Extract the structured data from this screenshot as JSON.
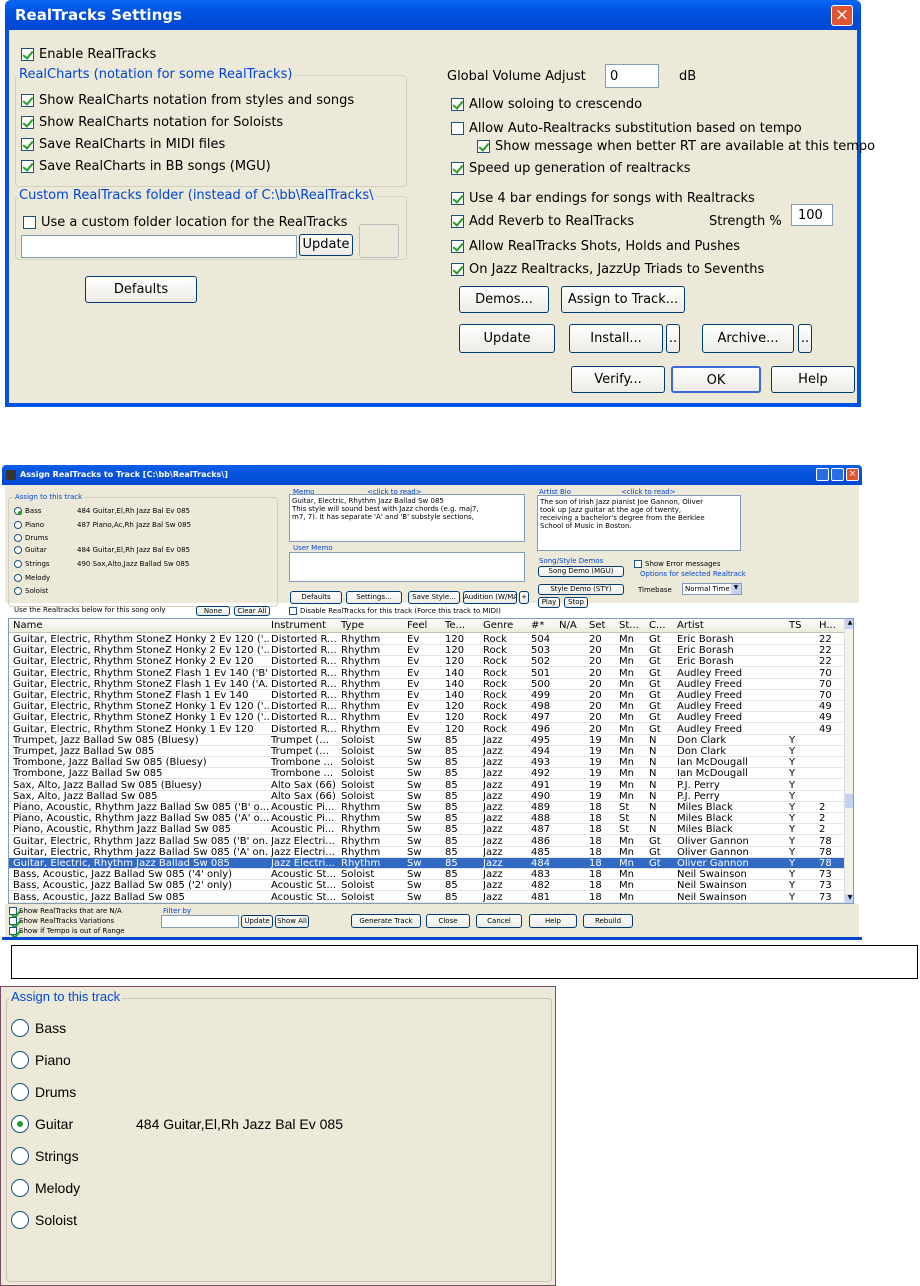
{
  "settings": {
    "title": "RealTracks Settings",
    "enable": "Enable RealTracks",
    "realcharts_group": "RealCharts (notation for some RealTracks)",
    "rc1": "Show RealCharts notation from styles and songs",
    "rc2": "Show RealCharts notation for Soloists",
    "rc3": "Save RealCharts in MIDI files",
    "rc4": "Save RealCharts in BB songs (MGU)",
    "custom_group": "Custom RealTracks folder (instead of C:\\bb\\RealTracks\\",
    "custom_cb": "Use a custom folder location for the RealTracks",
    "update_small": "Update",
    "defaults": "Defaults",
    "gva_label": "Global Volume Adjust",
    "gva_value": "0",
    "gva_unit": "dB",
    "o1": "Allow soloing to crescendo",
    "o2": "Allow Auto-Realtracks substitution based on tempo",
    "o3": "Show message when better RT are available at this tempo",
    "o4": "Speed up generation of realtracks",
    "o5": "Use 4 bar endings for songs with Realtracks",
    "o6": "Add Reverb to RealTracks",
    "strength_label": "Strength %",
    "strength_value": "100",
    "o7": "Allow RealTracks Shots, Holds and Pushes",
    "o8": "On Jazz Realtracks, JazzUp Triads to Sevenths",
    "demos": "Demos...",
    "assign": "Assign to Track...",
    "update": "Update",
    "install": "Install...",
    "archive": "Archive...",
    "dots": "..",
    "verify": "Verify...",
    "ok": "OK",
    "help": "Help",
    "close": "×"
  },
  "assign": {
    "title": "Assign RealTracks to Track  [C:\\bb\\RealTracks\\]",
    "group": "Assign to this track",
    "tracks": [
      {
        "name": "Bass",
        "value": "484 Guitar,El,Rh Jazz Bal Ev 085"
      },
      {
        "name": "Piano",
        "value": "487 Piano,Ac,Rh Jazz Bal Sw 085"
      },
      {
        "name": "Drums",
        "value": ""
      },
      {
        "name": "Guitar",
        "value": "484 Guitar,El,Rh Jazz Bal Ev 085"
      },
      {
        "name": "Strings",
        "value": "490 Sax,Alto,Jazz Ballad Sw 085"
      },
      {
        "name": "Melody",
        "value": ""
      },
      {
        "name": "Soloist",
        "value": ""
      }
    ],
    "use_below": "Use the Realtracks below for this song only",
    "none": "None",
    "clear_all": "Clear All",
    "memo": "Memo",
    "click_read": "<click to read>",
    "memo_text": [
      "Guitar, Electric, Rhythm Jazz Ballad Sw 085",
      "This style will sound best with Jazz chords (e.g. maj7,",
      "m7, 7).  It has separate 'A' and 'B' substyle sections,"
    ],
    "artist_bio": "Artist Bio",
    "bio_text": [
      "The son of Irish Jazz pianist Joe Gannon, Oliver",
      "took up Jazz guitar at the age of twenty,",
      "receiving a bachelor's degree from the Berklee",
      "School of Music in Boston."
    ],
    "user_memo": "User Memo",
    "song_demos": "Song/Style Demos",
    "song_demo": "Song Demo (MGU)",
    "style_demo": "Style Demo (STY)",
    "play": "Play",
    "stop": "Stop",
    "show_err": "Show Error messages",
    "options_sel": "Options for selected Realtrack",
    "timebase": "Timebase",
    "timebase_val": "Normal Time",
    "b_defaults": "Defaults",
    "b_settings": "Settings...",
    "b_save": "Save Style...",
    "b_audition": "Audition (W/MA)",
    "b_plus": "+",
    "disable": "Disable RealTracks for this track (Force this track to MIDI)",
    "columns": [
      "Name",
      "Instrument",
      "Type",
      "Feel",
      "Te...",
      "Genre",
      "#*",
      "N/A",
      "Set",
      "St...",
      "C...",
      "Artist",
      "TS",
      "H..."
    ],
    "rows": [
      [
        "Guitar, Electric, Rhythm StoneZ Honky 2 Ev 120 ('...",
        "Distorted R...",
        "Rhythm",
        "Ev",
        "120",
        "Rock",
        "504",
        "",
        "20",
        "Mn",
        "Gt",
        "Eric Borash",
        "",
        "22"
      ],
      [
        "Guitar, Electric, Rhythm StoneZ Honky 2 Ev 120 ('...",
        "Distorted R...",
        "Rhythm",
        "Ev",
        "120",
        "Rock",
        "503",
        "",
        "20",
        "Mn",
        "Gt",
        "Eric Borash",
        "",
        "22"
      ],
      [
        "Guitar, Electric, Rhythm StoneZ Honky 2 Ev 120",
        "Distorted R...",
        "Rhythm",
        "Ev",
        "120",
        "Rock",
        "502",
        "",
        "20",
        "Mn",
        "Gt",
        "Eric Borash",
        "",
        "22"
      ],
      [
        "Guitar, Electric, Rhythm StoneZ Flash 1 Ev 140 ('B'...",
        "Distorted R...",
        "Rhythm",
        "Ev",
        "140",
        "Rock",
        "501",
        "",
        "20",
        "Mn",
        "Gt",
        "Audley Freed",
        "",
        "70"
      ],
      [
        "Guitar, Electric, Rhythm StoneZ Flash 1 Ev 140 ('A...",
        "Distorted R...",
        "Rhythm",
        "Ev",
        "140",
        "Rock",
        "500",
        "",
        "20",
        "Mn",
        "Gt",
        "Audley Freed",
        "",
        "70"
      ],
      [
        "Guitar, Electric, Rhythm StoneZ Flash 1 Ev 140",
        "Distorted R...",
        "Rhythm",
        "Ev",
        "140",
        "Rock",
        "499",
        "",
        "20",
        "Mn",
        "Gt",
        "Audley Freed",
        "",
        "70"
      ],
      [
        "Guitar, Electric, Rhythm StoneZ Honky 1 Ev 120 ('...",
        "Distorted R...",
        "Rhythm",
        "Ev",
        "120",
        "Rock",
        "498",
        "",
        "20",
        "Mn",
        "Gt",
        "Audley Freed",
        "",
        "49"
      ],
      [
        "Guitar, Electric, Rhythm StoneZ Honky 1 Ev 120 ('...",
        "Distorted R...",
        "Rhythm",
        "Ev",
        "120",
        "Rock",
        "497",
        "",
        "20",
        "Mn",
        "Gt",
        "Audley Freed",
        "",
        "49"
      ],
      [
        "Guitar, Electric, Rhythm StoneZ Honky 1 Ev 120",
        "Distorted R...",
        "Rhythm",
        "Ev",
        "120",
        "Rock",
        "496",
        "",
        "20",
        "Mn",
        "Gt",
        "Audley Freed",
        "",
        "49"
      ],
      [
        "Trumpet, Jazz Ballad Sw 085 (Bluesy)",
        "Trumpet (...",
        "Soloist",
        "Sw",
        "85",
        "Jazz",
        "495",
        "",
        "19",
        "Mn",
        "N",
        "Don Clark",
        "Y",
        ""
      ],
      [
        "Trumpet, Jazz Ballad Sw 085",
        "Trumpet (...",
        "Soloist",
        "Sw",
        "85",
        "Jazz",
        "494",
        "",
        "19",
        "Mn",
        "N",
        "Don Clark",
        "Y",
        ""
      ],
      [
        "Trombone, Jazz Ballad Sw 085 (Bluesy)",
        "Trombone ...",
        "Soloist",
        "Sw",
        "85",
        "Jazz",
        "493",
        "",
        "19",
        "Mn",
        "N",
        "Ian McDougall",
        "Y",
        ""
      ],
      [
        "Trombone, Jazz Ballad Sw 085",
        "Trombone ...",
        "Soloist",
        "Sw",
        "85",
        "Jazz",
        "492",
        "",
        "19",
        "Mn",
        "N",
        "Ian McDougall",
        "Y",
        ""
      ],
      [
        "Sax, Alto, Jazz Ballad Sw 085 (Bluesy)",
        "Alto Sax (66)",
        "Soloist",
        "Sw",
        "85",
        "Jazz",
        "491",
        "",
        "19",
        "Mn",
        "N",
        "P.J. Perry",
        "Y",
        ""
      ],
      [
        "Sax, Alto, Jazz Ballad Sw 085",
        "Alto Sax (66)",
        "Soloist",
        "Sw",
        "85",
        "Jazz",
        "490",
        "",
        "19",
        "Mn",
        "N",
        "P.J. Perry",
        "Y",
        ""
      ],
      [
        "Piano, Acoustic, Rhythm Jazz Ballad Sw 085 ('B' o...",
        "Acoustic Pi...",
        "Rhythm",
        "Sw",
        "85",
        "Jazz",
        "489",
        "",
        "18",
        "St",
        "N",
        "Miles Black",
        "Y",
        "2"
      ],
      [
        "Piano, Acoustic, Rhythm Jazz Ballad Sw 085 ('A' o...",
        "Acoustic Pi...",
        "Rhythm",
        "Sw",
        "85",
        "Jazz",
        "488",
        "",
        "18",
        "St",
        "N",
        "Miles Black",
        "Y",
        "2"
      ],
      [
        "Piano, Acoustic, Rhythm Jazz Ballad Sw 085",
        "Acoustic Pi...",
        "Rhythm",
        "Sw",
        "85",
        "Jazz",
        "487",
        "",
        "18",
        "St",
        "N",
        "Miles Black",
        "Y",
        "2"
      ],
      [
        "Guitar, Electric, Rhythm Jazz Ballad Sw 085 ('B' on...",
        "Jazz Electri...",
        "Rhythm",
        "Sw",
        "85",
        "Jazz",
        "486",
        "",
        "18",
        "Mn",
        "Gt",
        "Oliver Gannon",
        "Y",
        "78"
      ],
      [
        "Guitar, Electric, Rhythm Jazz Ballad Sw 085 ('A' on...",
        "Jazz Electri...",
        "Rhythm",
        "Sw",
        "85",
        "Jazz",
        "485",
        "",
        "18",
        "Mn",
        "Gt",
        "Oliver Gannon",
        "Y",
        "78"
      ],
      [
        "Guitar, Electric, Rhythm Jazz Ballad Sw 085",
        "Jazz Electri...",
        "Rhythm",
        "Sw",
        "85",
        "Jazz",
        "484",
        "",
        "18",
        "Mn",
        "Gt",
        "Oliver Gannon",
        "Y",
        "78"
      ],
      [
        "Bass, Acoustic, Jazz Ballad Sw 085 ('4' only)",
        "Acoustic St...",
        "Soloist",
        "Sw",
        "85",
        "Jazz",
        "483",
        "",
        "18",
        "Mn",
        "",
        "Neil Swainson",
        "Y",
        "73"
      ],
      [
        "Bass, Acoustic, Jazz Ballad Sw 085 ('2' only)",
        "Acoustic St...",
        "Soloist",
        "Sw",
        "85",
        "Jazz",
        "482",
        "",
        "18",
        "Mn",
        "",
        "Neil Swainson",
        "Y",
        "73"
      ],
      [
        "Bass, Acoustic, Jazz Ballad Sw 085",
        "Acoustic St...",
        "Soloist",
        "Sw",
        "85",
        "Jazz",
        "481",
        "",
        "18",
        "Mn",
        "",
        "Neil Swainson",
        "Y",
        "73"
      ]
    ],
    "show_na": "Show RealTracks that are N/A",
    "show_var": "Show RealTracks Variations",
    "show_tempo": "Show if Tempo is out of Range",
    "filter_by": "Filter by",
    "update": "Update",
    "show_all": "Show All",
    "generate": "Generate Track",
    "close": "Close",
    "cancel": "Cancel",
    "help": "Help",
    "rebuild": "Rebuild"
  },
  "zoom": {
    "group": "Assign to this track",
    "tracks": [
      {
        "name": "Bass",
        "value": ""
      },
      {
        "name": "Piano",
        "value": ""
      },
      {
        "name": "Drums",
        "value": ""
      },
      {
        "name": "Guitar",
        "value": "484 Guitar,El,Rh Jazz Bal Ev 085"
      },
      {
        "name": "Strings",
        "value": ""
      },
      {
        "name": "Melody",
        "value": ""
      },
      {
        "name": "Soloist",
        "value": ""
      }
    ]
  }
}
